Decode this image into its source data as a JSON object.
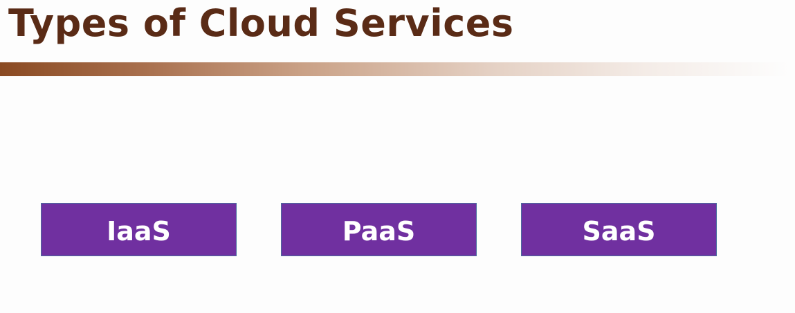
{
  "slide": {
    "title": "Types of Cloud Services"
  },
  "services": [
    {
      "label": "IaaS"
    },
    {
      "label": "PaaS"
    },
    {
      "label": "SaaS"
    }
  ],
  "colors": {
    "title_text": "#5a2b16",
    "accent_bar_start": "#8a4a22",
    "box_fill": "#7030a0",
    "box_border": "#4a6fa0",
    "box_text": "#ffffff",
    "background": "#fdfdfd"
  }
}
